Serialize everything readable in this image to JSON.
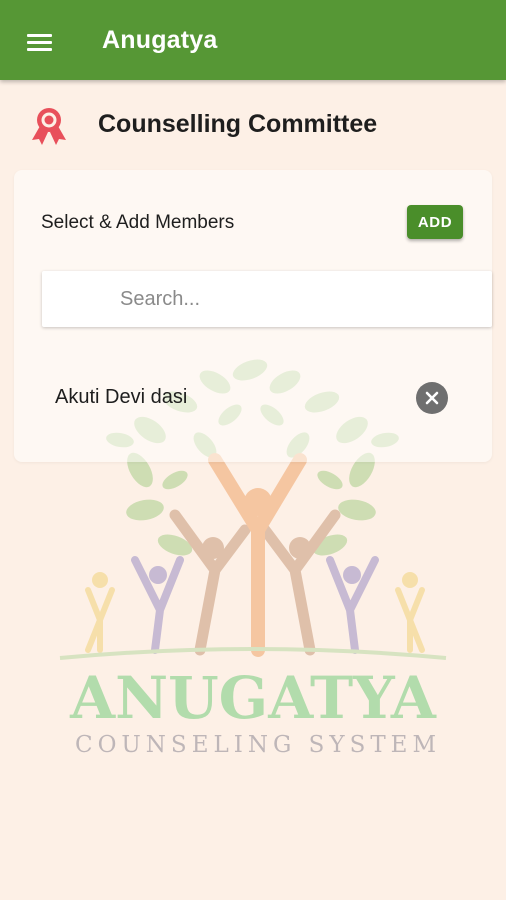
{
  "app_bar": {
    "title": "Anugatya",
    "menu_icon": "menu-icon",
    "color": "#569735"
  },
  "section": {
    "title": "Counselling Committee",
    "icon": "award-ribbon-icon",
    "icon_color": "#e8505b"
  },
  "members_card": {
    "label": "Select & Add Members",
    "add_button": "ADD",
    "search": {
      "placeholder": "Search...",
      "value": ""
    },
    "selected_members": [
      {
        "name": "Akuti Devi dasi",
        "remove_icon": "close-circle-icon"
      }
    ]
  },
  "watermark": {
    "brand": "ANUGATYA",
    "tagline": "COUNSELING SYSTEM"
  }
}
